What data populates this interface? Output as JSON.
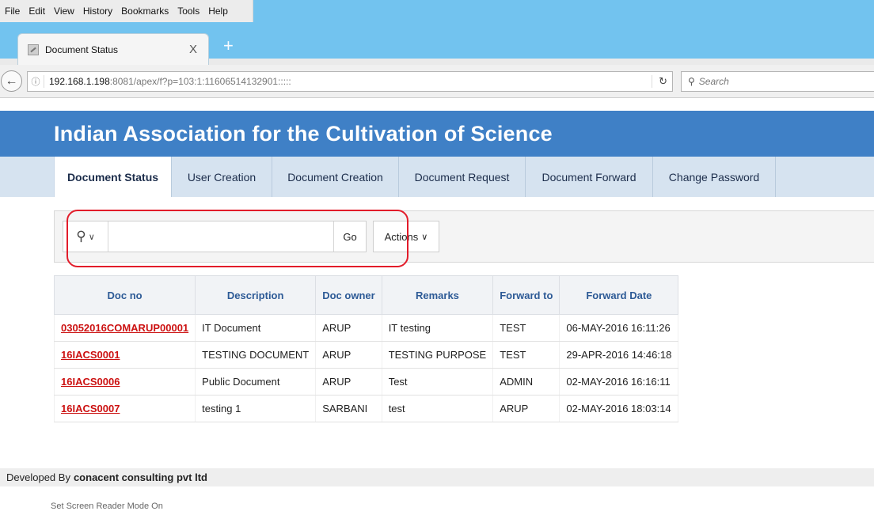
{
  "menubar": [
    "File",
    "Edit",
    "View",
    "History",
    "Bookmarks",
    "Tools",
    "Help"
  ],
  "browser_tab": {
    "title": "Document Status",
    "close": "X",
    "new_tab": "+"
  },
  "url": {
    "host": "192.168.1.198",
    "rest": ":8081/apex/f?p=103:1:11606514132901:::::"
  },
  "browser_search": {
    "placeholder": "Search"
  },
  "app_title": "Indian Association for the Cultivation of Science",
  "nav_tabs": [
    {
      "label": "Document Status",
      "active": true
    },
    {
      "label": "User Creation"
    },
    {
      "label": "Document Creation"
    },
    {
      "label": "Document Request"
    },
    {
      "label": "Document Forward"
    },
    {
      "label": "Change Password"
    }
  ],
  "search": {
    "go_label": "Go",
    "actions_label": "Actions",
    "value": ""
  },
  "table": {
    "headers": [
      "Doc no",
      "Description",
      "Doc owner",
      "Remarks",
      "Forward to",
      "Forward Date"
    ],
    "rows": [
      [
        "03052016COMARUP00001",
        "IT Document",
        "ARUP",
        "IT testing",
        "TEST",
        "06-MAY-2016 16:11:26"
      ],
      [
        "16IACS0001",
        "TESTING DOCUMENT",
        "ARUP",
        "TESTING PURPOSE",
        "TEST",
        "29-APR-2016 14:46:18"
      ],
      [
        "16IACS0006",
        "Public Document",
        "ARUP",
        "Test",
        "ADMIN",
        "02-MAY-2016 16:16:11"
      ],
      [
        "16IACS0007",
        "testing 1",
        "SARBANI",
        "test",
        "ARUP",
        "02-MAY-2016 18:03:14"
      ]
    ]
  },
  "footer": {
    "prefix": "Developed By",
    "company": "conacent consulting pvt ltd",
    "screen_reader": "Set Screen Reader Mode On"
  },
  "colors": {
    "banner": "#3f80c6",
    "nav_bg": "#d6e3f0",
    "link": "#cc1111",
    "header_text": "#2d5a96",
    "highlight": "#e21c2a"
  }
}
